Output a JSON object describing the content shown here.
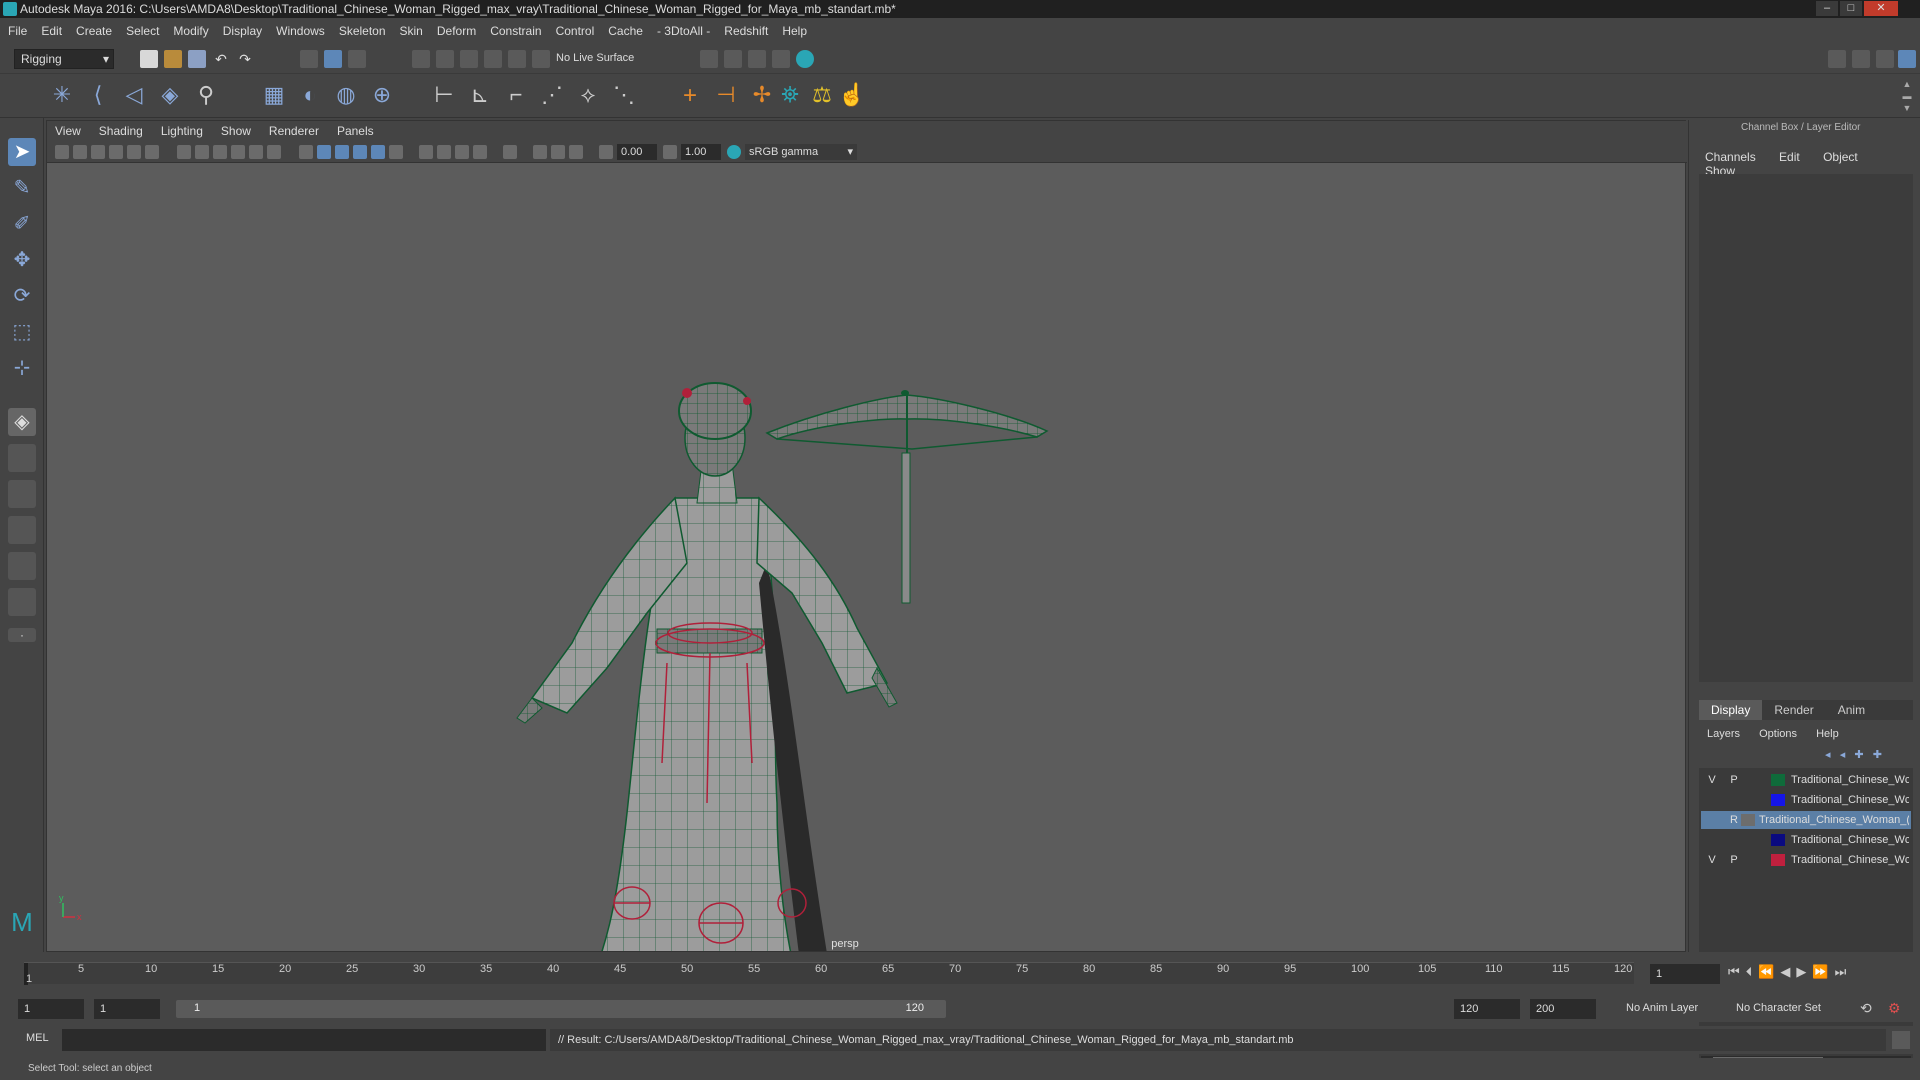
{
  "window": {
    "title": "Autodesk Maya 2016: C:\\Users\\AMDA8\\Desktop\\Traditional_Chinese_Woman_Rigged_max_vray\\Traditional_Chinese_Woman_Rigged_for_Maya_mb_standart.mb*",
    "minimize": "–",
    "maximize": "□",
    "close": "✕"
  },
  "menubar": [
    "File",
    "Edit",
    "Create",
    "Select",
    "Modify",
    "Display",
    "Windows",
    "Skeleton",
    "Skin",
    "Deform",
    "Constrain",
    "Control",
    "Cache",
    "- 3DtoAll -",
    "Redshift",
    "Help"
  ],
  "statusline": {
    "menuset": "Rigging",
    "live_surface": "No Live Surface"
  },
  "panel_menu": [
    "View",
    "Shading",
    "Lighting",
    "Show",
    "Renderer",
    "Panels"
  ],
  "panel_toolbar": {
    "exposure": "0.00",
    "gamma": "1.00",
    "color_space": "sRGB gamma"
  },
  "viewport": {
    "camera_label": "persp",
    "axis_x": "x",
    "axis_y": "y",
    "colors": {
      "wire": "#0f6b3a",
      "rig": "#b0203a",
      "mesh": "#9a9a9a"
    }
  },
  "channel_box": {
    "header": "Channel Box / Layer Editor",
    "tabs": [
      "Channels",
      "Edit",
      "Object",
      "Show"
    ]
  },
  "layer_editor": {
    "tabs": [
      "Display",
      "Render",
      "Anim"
    ],
    "menu": [
      "Layers",
      "Options",
      "Help"
    ],
    "layers": [
      {
        "v": "V",
        "p": "P",
        "color": "#0f6b3a",
        "name": "Traditional_Chinese_Wc",
        "selected": false
      },
      {
        "v": "",
        "p": "",
        "color": "#1515e8",
        "name": "Traditional_Chinese_Wc",
        "selected": false
      },
      {
        "v": "",
        "p": "R",
        "color": "#6d6d6d",
        "name": "Traditional_Chinese_Woman_(",
        "selected": true
      },
      {
        "v": "",
        "p": "",
        "color": "#0a0a80",
        "name": "Traditional_Chinese_Wc",
        "selected": false
      },
      {
        "v": "V",
        "p": "P",
        "color": "#c0203e",
        "name": "Traditional_Chinese_Wc",
        "selected": false
      }
    ]
  },
  "timeline": {
    "ticks": [
      "1",
      "5",
      "10",
      "15",
      "20",
      "25",
      "30",
      "35",
      "40",
      "45",
      "50",
      "55",
      "60",
      "65",
      "70",
      "75",
      "80",
      "85",
      "90",
      "95",
      "100",
      "105",
      "110",
      "115",
      "120"
    ],
    "current_frame": "1"
  },
  "range": {
    "start": "1",
    "playback_start": "1",
    "slider_start": "1",
    "slider_end": "120",
    "playback_end": "120",
    "end": "200",
    "anim_layer": "No Anim Layer",
    "character_set": "No Character Set"
  },
  "command_line": {
    "mode": "MEL",
    "result": "// Result: C:/Users/AMDA8/Desktop/Traditional_Chinese_Woman_Rigged_max_vray/Traditional_Chinese_Woman_Rigged_for_Maya_mb_standart.mb"
  },
  "help_line": "Select Tool: select an object"
}
